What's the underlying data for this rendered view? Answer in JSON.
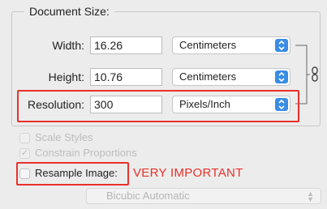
{
  "document_size": {
    "legend": "Document Size:",
    "width": {
      "label": "Width:",
      "value": "16.26",
      "unit": "Centimeters"
    },
    "height": {
      "label": "Height:",
      "value": "10.76",
      "unit": "Centimeters"
    },
    "resolution": {
      "label": "Resolution:",
      "value": "300",
      "unit": "Pixels/Inch"
    },
    "link_icon": "chain-link-icon"
  },
  "options": {
    "scale_styles": {
      "label": "Scale Styles",
      "checked": false,
      "enabled": false
    },
    "constrain_proportions": {
      "label": "Constrain Proportions",
      "checked": true,
      "enabled": false
    },
    "resample_image": {
      "label": "Resample Image:",
      "checked": false,
      "enabled": true
    },
    "resample_method": "Bicubic Automatic"
  },
  "annotation": {
    "text": "VERY IMPORTANT",
    "color": "#e8312c"
  },
  "colors": {
    "highlight": "#e8312c",
    "accent": "#3a8de5"
  }
}
